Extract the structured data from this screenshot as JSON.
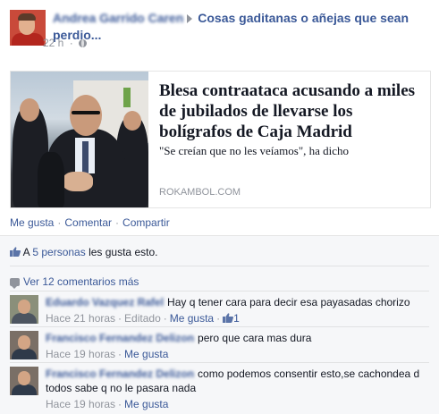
{
  "post": {
    "author": "Andrea Garrido Caren",
    "group": "Cosas gaditanas o añejas que sean perdio...",
    "time": "22 h",
    "dot": "·"
  },
  "share": {
    "title": "Blesa contraataca acusando a miles de jubilados de llevarse los bolígrafos de Caja Madrid",
    "subtitle": "\"Se creían que no les veíamos\", ha dicho",
    "domain": "ROKAMBOL.COM"
  },
  "actions": {
    "like": "Me gusta",
    "comment": "Comentar",
    "share": "Compartir",
    "sep": "·"
  },
  "likes": {
    "prefix": "A",
    "count_link": "5 personas",
    "suffix": "les gusta esto."
  },
  "more_comments": "Ver 12 comentarios más",
  "comments": [
    {
      "author": "Eduardo Vazquez Rafel",
      "text": "Hay q tener cara para decir esa payasadas chorizo",
      "time": "Hace 21 horas",
      "edited": "Editado",
      "like": "Me gusta",
      "like_count": "1"
    },
    {
      "author": "Francisco Fernandez Delizon",
      "text": "pero que cara mas dura",
      "time": "Hace 19 horas",
      "like": "Me gusta"
    },
    {
      "author": "Francisco Fernandez Delizon",
      "text": "como podemos consentir esto,se cachondea d todos sabe q no le pasara nada",
      "time": "Hace 19 horas",
      "like": "Me gusta"
    }
  ],
  "colors": {
    "link": "#3b5998",
    "muted": "#90949c",
    "ufi_bg": "#f6f7f9",
    "border": "#e5e5e5"
  },
  "icons": {
    "avatar": "profile-photo",
    "arrow": "triangle-right-icon",
    "privacy": "globe-icon",
    "like": "thumbs-up-icon",
    "comments": "speech-bubble-icon"
  }
}
